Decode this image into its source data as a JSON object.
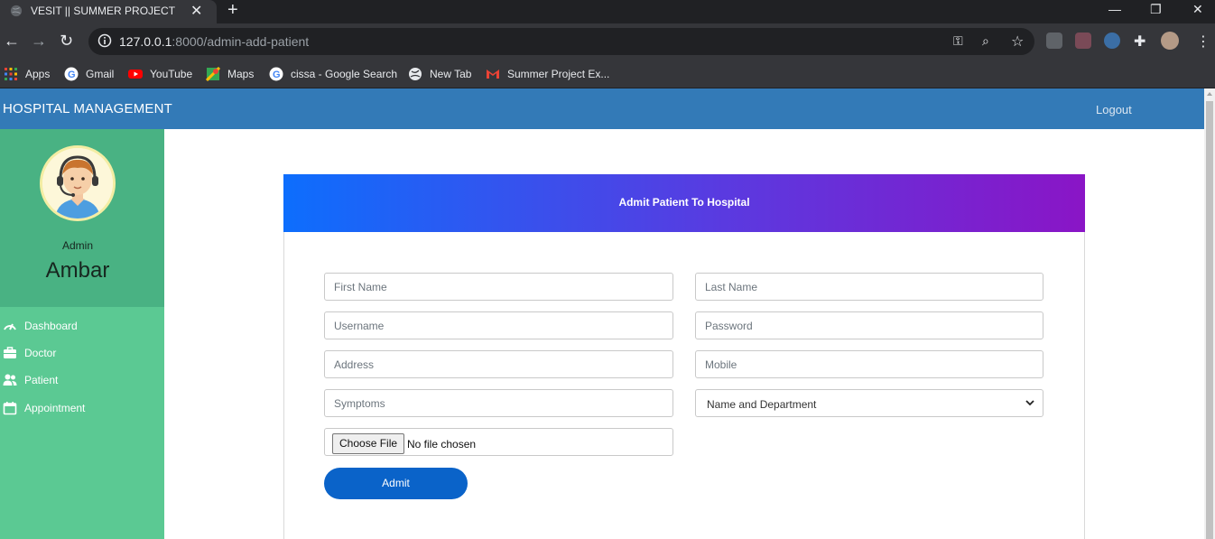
{
  "browser": {
    "tab_title": "VESIT || SUMMER PROJECT",
    "tab_close": "✕",
    "new_tab": "+",
    "url_host": "127.0.0.1",
    "url_path": ":8000/admin-add-patient",
    "window_controls": [
      "—",
      "❐",
      "✕"
    ],
    "bookmarks": [
      {
        "label": "Apps",
        "icon": "apps-grid-icon"
      },
      {
        "label": "Gmail",
        "icon": "google-icon"
      },
      {
        "label": "YouTube",
        "icon": "youtube-icon"
      },
      {
        "label": "Maps",
        "icon": "maps-icon"
      },
      {
        "label": "cissa - Google Search",
        "icon": "google-icon"
      },
      {
        "label": "New Tab",
        "icon": "globe-icon"
      },
      {
        "label": "Summer Project Ex...",
        "icon": "gmail-icon"
      }
    ]
  },
  "navbar": {
    "brand": "HOSPITAL MANAGEMENT",
    "logout": "Logout",
    "color": "#337ab7"
  },
  "sidebar": {
    "role": "Admin",
    "username": "Ambar",
    "items": [
      {
        "label": "Dashboard",
        "icon": "speedometer-icon"
      },
      {
        "label": "Doctor",
        "icon": "briefcase-icon"
      },
      {
        "label": "Patient",
        "icon": "users-icon"
      },
      {
        "label": "Appointment",
        "icon": "calendar-icon"
      }
    ],
    "color": "#5bc993"
  },
  "form": {
    "title": "Admit Patient To Hospital",
    "first_name_placeholder": "First Name",
    "last_name_placeholder": "Last Name",
    "username_placeholder": "Username",
    "password_placeholder": "Password",
    "address_placeholder": "Address",
    "mobile_placeholder": "Mobile",
    "symptoms_placeholder": "Symptoms",
    "doctor_select_value": "Name and Department",
    "file_button": "Choose File",
    "file_status": "No file chosen",
    "submit_label": "Admit",
    "accent": "#0a63c9"
  }
}
